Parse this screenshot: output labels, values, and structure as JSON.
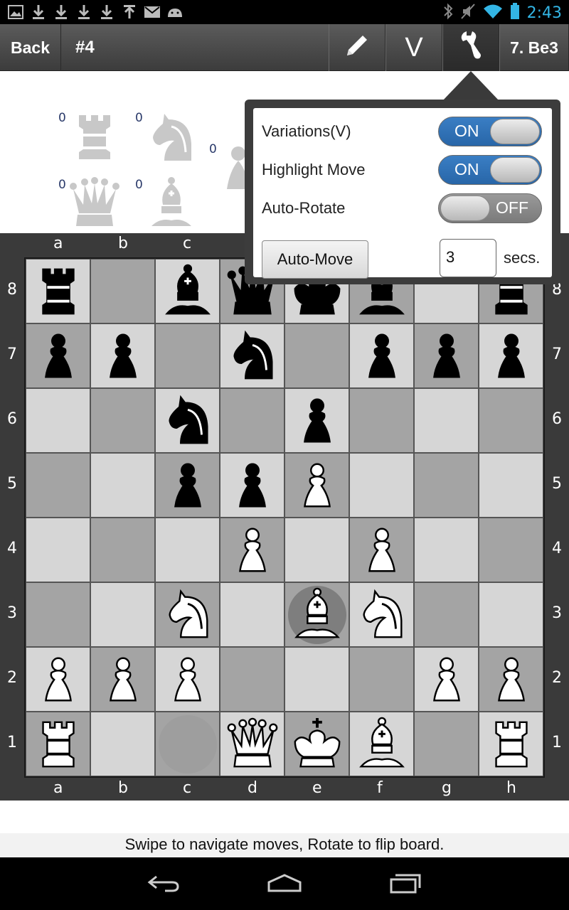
{
  "status_bar": {
    "time": "2:43"
  },
  "action_bar": {
    "back_label": "Back",
    "game_title": "#4",
    "variations_label": "V",
    "last_move": "7. Be3"
  },
  "captured": [
    {
      "count": "0",
      "piece": "rook"
    },
    {
      "count": "0",
      "piece": "knight"
    },
    {
      "count": "0",
      "piece": "pawn"
    },
    {
      "count": "0",
      "piece": "queen"
    },
    {
      "count": "0",
      "piece": "bishop"
    }
  ],
  "board": {
    "files": [
      "a",
      "b",
      "c",
      "d",
      "e",
      "f",
      "g",
      "h"
    ],
    "ranks": [
      "8",
      "7",
      "6",
      "5",
      "4",
      "3",
      "2",
      "1"
    ],
    "position": [
      [
        "bR",
        "",
        "bB",
        "bQ",
        "bK",
        "bB",
        "",
        "bR"
      ],
      [
        "bP",
        "bP",
        "",
        "bN",
        "",
        "bP",
        "bP",
        "bP"
      ],
      [
        "",
        "",
        "bN",
        "",
        "bP",
        "",
        "",
        ""
      ],
      [
        "",
        "",
        "bP",
        "bP",
        "wP",
        "",
        "",
        ""
      ],
      [
        "",
        "",
        "",
        "wP",
        "",
        "wP",
        "",
        ""
      ],
      [
        "",
        "",
        "wN",
        "",
        "wB",
        "wN",
        "",
        ""
      ],
      [
        "wP",
        "wP",
        "wP",
        "",
        "",
        "",
        "wP",
        "wP"
      ],
      [
        "wR",
        "",
        "",
        "wQ",
        "wK",
        "wB",
        "",
        "wR"
      ]
    ],
    "highlight_to": "e3",
    "highlight_from": "c1"
  },
  "settings_popup": {
    "variations_label": "Variations(V)",
    "variations_state": "ON",
    "highlight_label": "Highlight Move",
    "highlight_state": "ON",
    "autorotate_label": "Auto-Rotate",
    "autorotate_state": "OFF",
    "automove_label": "Auto-Move",
    "secs_value": "3",
    "secs_label": "secs."
  },
  "hint": "Swipe to navigate moves, Rotate to flip board.",
  "colors": {
    "accent_blue": "#33b5e5",
    "toggle_on": "#2f72b8"
  },
  "icons": [
    "pencil-icon",
    "wrench-icon",
    "back-nav-icon",
    "home-nav-icon",
    "recents-nav-icon"
  ]
}
